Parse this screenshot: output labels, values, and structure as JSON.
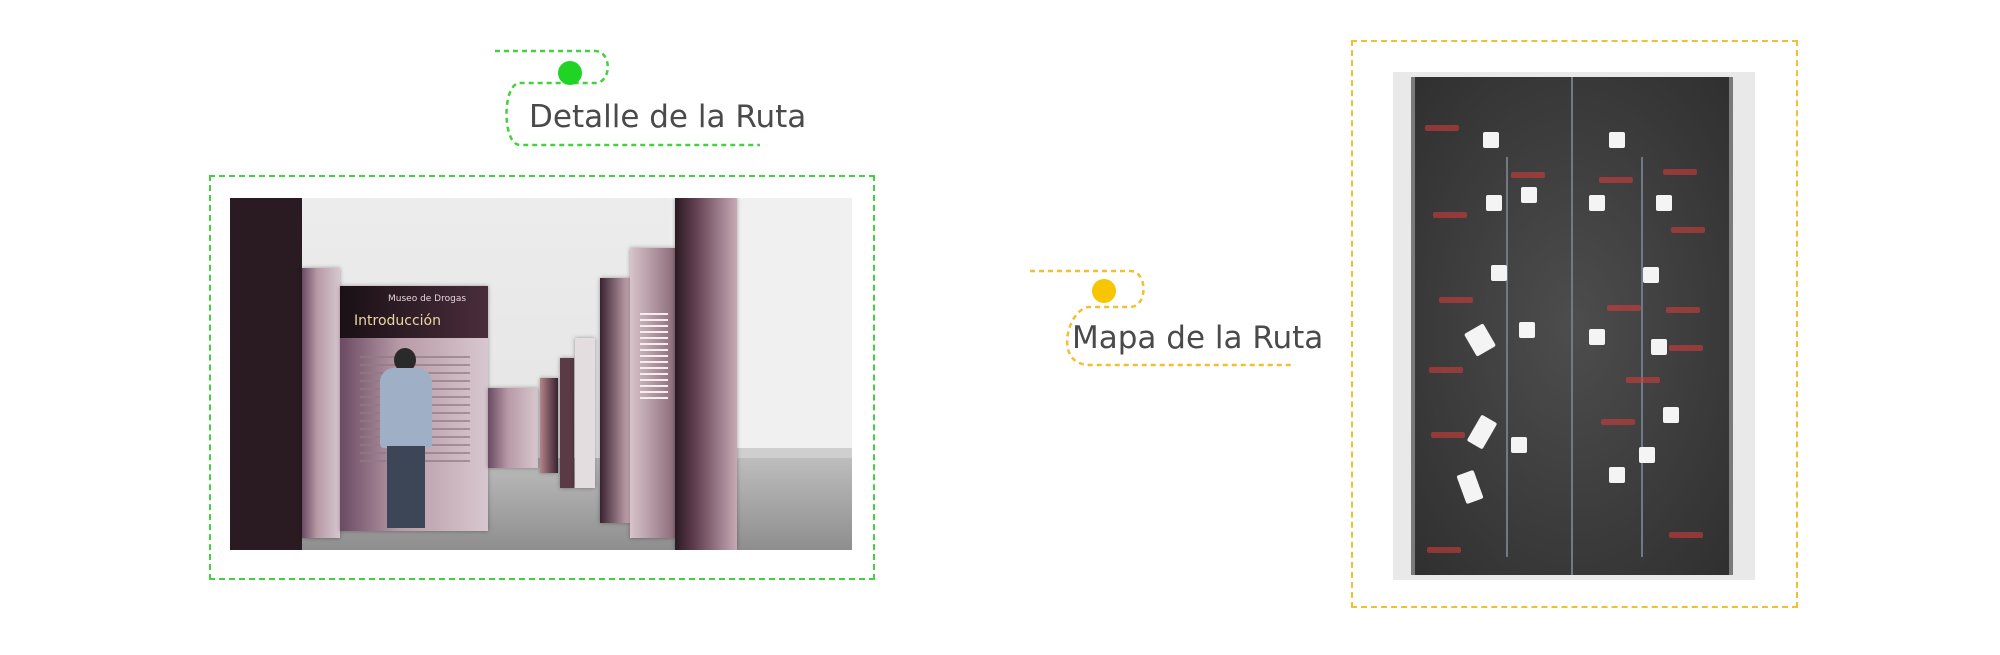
{
  "route_detail": {
    "label": "Detalle de la Ruta",
    "dot_color": "#1fd424",
    "frame_color": "#43d13f",
    "image": {
      "panel_header": "Museo de Drogas",
      "panel_title": "Introducción"
    }
  },
  "route_map": {
    "label": "Mapa de la Ruta",
    "dot_color": "#f7c600",
    "frame_color": "#f0c030"
  }
}
